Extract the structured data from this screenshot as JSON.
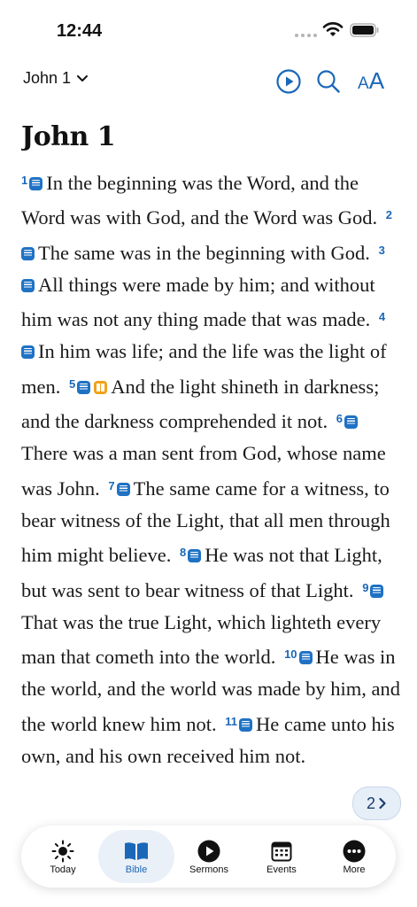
{
  "status_bar": {
    "time": "12:44"
  },
  "nav": {
    "chapter_selector": "John 1",
    "text_size_label_small": "A",
    "text_size_label_big": "A"
  },
  "chapter": {
    "title": "John 1",
    "verses": [
      {
        "num": "1",
        "text": "In the beginning was the Word, and the Word was with God, and the Word was God."
      },
      {
        "num": "2",
        "text": "The same was in the beginning with God."
      },
      {
        "num": "3",
        "text": "All things were made by him; and without him was not any thing made that was made."
      },
      {
        "num": "4",
        "text": "In him was life; and the life was the light of men."
      },
      {
        "num": "5",
        "text": "And the light shineth in darkness; and the darkness comprehended it not."
      },
      {
        "num": "6",
        "text": "There was a man sent from God, whose name was John."
      },
      {
        "num": "7",
        "text": "The same came for a witness, to bear witness of the Light, that all men through him might believe."
      },
      {
        "num": "8",
        "text": "He was not that Light, but was sent to bear witness of that Light."
      },
      {
        "num": "9",
        "text": "That was the true Light, which lighteth every man that cometh into the world."
      },
      {
        "num": "10",
        "text": "He was in the world, and the world was made by him, and the world knew him not."
      },
      {
        "num": "11",
        "text": "He came unto his own, and his own received him not."
      }
    ]
  },
  "page_indicator": {
    "label": "2"
  },
  "tabs": [
    {
      "label": "Today",
      "icon": "sun-icon"
    },
    {
      "label": "Bible",
      "icon": "open-book-icon",
      "active": true
    },
    {
      "label": "Sermons",
      "icon": "play-circle-icon"
    },
    {
      "label": "Events",
      "icon": "calendar-icon"
    },
    {
      "label": "More",
      "icon": "ellipsis-circle-icon"
    }
  ],
  "colors": {
    "accent": "#1a67b8",
    "note_icon": "#1f72c4",
    "book_icon": "#f2a11a",
    "active_tab_bg": "#eaf0f7"
  }
}
